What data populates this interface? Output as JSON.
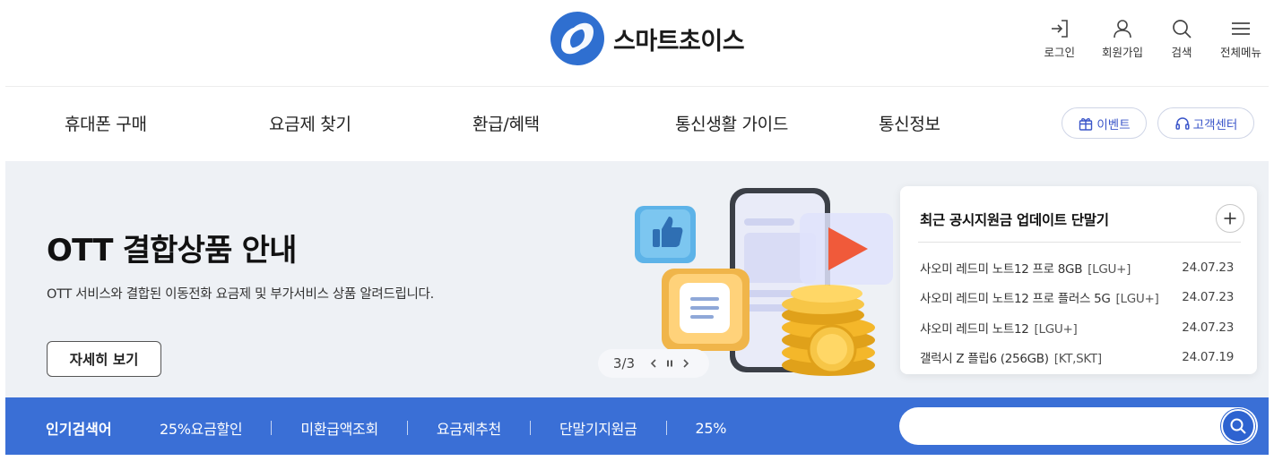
{
  "header": {
    "logo_text": "스마트초이스",
    "util_nav": [
      {
        "icon": "login-icon",
        "label": "로그인"
      },
      {
        "icon": "user-icon",
        "label": "회원가입"
      },
      {
        "icon": "search-icon",
        "label": "검색"
      },
      {
        "icon": "menu-icon",
        "label": "전체메뉴"
      }
    ]
  },
  "gnb": {
    "items": [
      "휴대폰 구매",
      "요금제 찾기",
      "환급/혜택",
      "통신생활 가이드",
      "통신정보"
    ],
    "event_label": "이벤트",
    "support_label": "고객센터"
  },
  "hero": {
    "title": "OTT 결합상품 안내",
    "description": "OTT 서비스와 결합된 이동전화 요금제 및 부가서비스 상품 알려드립니다.",
    "button_label": "자세히 보기",
    "slide_counter": "3/3"
  },
  "update_card": {
    "title": "최근 공시지원금 업데이트 단말기",
    "rows": [
      {
        "name": "사오미 레드미 노트12 프로 8GB",
        "carrier": "[LGU+]",
        "date": "24.07.23"
      },
      {
        "name": "사오미 레드미 노트12 프로 플러스 5G",
        "carrier": "[LGU+]",
        "date": "24.07.23"
      },
      {
        "name": "샤오미 레드미 노트12",
        "carrier": "[LGU+]",
        "date": "24.07.23"
      },
      {
        "name": "갤럭시 Z 플립6 (256GB)",
        "carrier": "[KT,SKT]",
        "date": "24.07.19"
      }
    ]
  },
  "keywords": {
    "title": "인기검색어",
    "items": [
      "25%요금할인",
      "미환급액조회",
      "요금제추천",
      "단말기지원금",
      "25%"
    ],
    "search_placeholder": ""
  },
  "colors": {
    "brand_blue": "#3a6fd6",
    "accent_blue": "#3a55c9",
    "hero_bg": "#eef1f5"
  }
}
